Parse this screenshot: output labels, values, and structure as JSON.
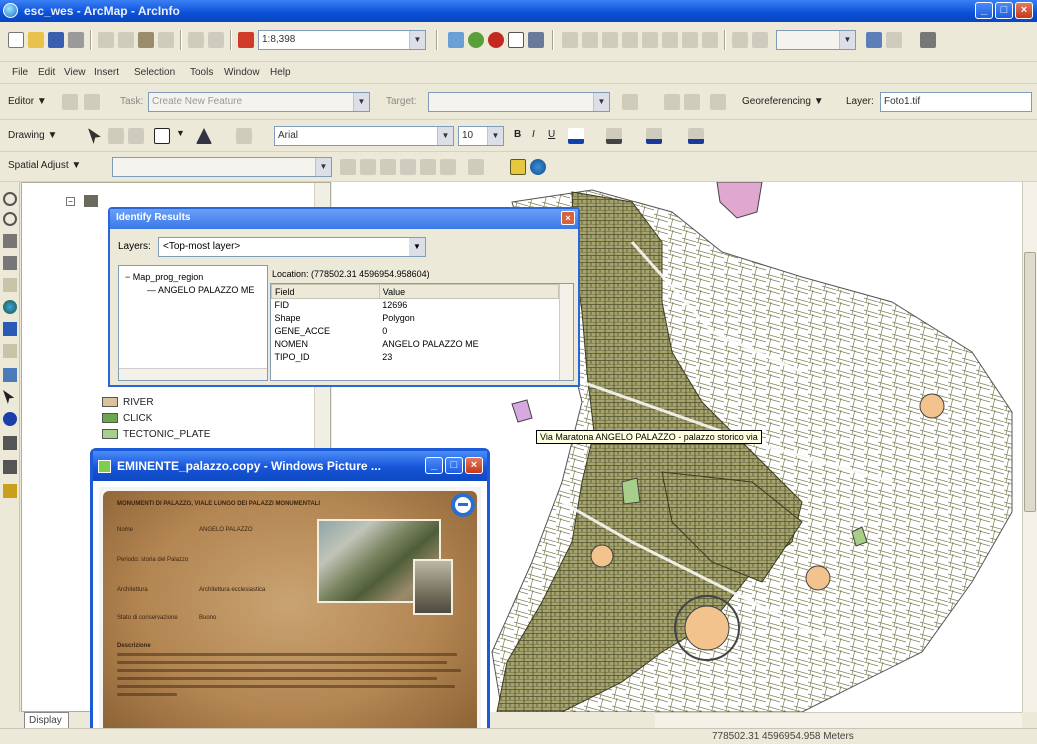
{
  "window": {
    "title": "esc_wes - ArcMap - ArcInfo"
  },
  "toolbar": {
    "scale_value": "1:8,398"
  },
  "menu": [
    "File",
    "Edit",
    "View",
    "Insert",
    "Selection",
    "Tools",
    "Window",
    "Help"
  ],
  "editor": {
    "label": "Editor ▼",
    "task_label": "Task:",
    "task_value": "Create New Feature",
    "target_label": "Target:"
  },
  "georef": {
    "label": "Georeferencing ▼",
    "layer_label": "Layer:",
    "layer_value": "Foto1.tif"
  },
  "drawing": {
    "label": "Drawing ▼",
    "font_value": "Arial",
    "font_size": "10"
  },
  "spatial_adjust": {
    "label": "Spatial Adjust ▼"
  },
  "toc": {
    "legend": [
      {
        "label": "RIVER",
        "color": "#d9c49a"
      },
      {
        "label": "CLICK",
        "color": "#6aa84f"
      },
      {
        "label": "TECTONIC_PLATE",
        "color": "#a8cf8a"
      }
    ],
    "tab_label": "Display"
  },
  "identify": {
    "title": "Identify Results",
    "layers_label": "Layers:",
    "layers_value": "<Top-most layer>",
    "tree_root": "Map_prog_region",
    "tree_child": "ANGELO PALAZZO ME",
    "location": "Location: (778502.31 4596954.958604)",
    "columns": [
      "Field",
      "Value"
    ],
    "rows": [
      [
        "FID",
        "12696"
      ],
      [
        "Shape",
        "Polygon"
      ],
      [
        "GENE_ACCE",
        "0"
      ],
      [
        "NOMEN",
        "ANGELO PALAZZO ME"
      ],
      [
        "TIPO_ID",
        "23"
      ]
    ]
  },
  "maptip": {
    "text": "Via Maratona ANGELO PALAZZO - palazzo storico via"
  },
  "hyperlink": {
    "title": "EMINENTE_palazzo.copy - Windows Picture ...",
    "doc_heading": "MONUMENTI DI PALAZZO, VIALE LUNGO DEI PALAZZI MONUMENTALI",
    "fields": [
      {
        "label": "Nome",
        "value": "ANGELO PALAZZO"
      },
      {
        "label": "Periodo: storia del Palazzo",
        "value": ""
      },
      {
        "label": "Architettura",
        "value": "Architettura ecclesiastica"
      },
      {
        "label": "Stato di conservazione",
        "value": "Buono"
      }
    ],
    "description_label": "Descrizione"
  },
  "status": {
    "coords": "778502.31 4596954.958 Meters"
  }
}
